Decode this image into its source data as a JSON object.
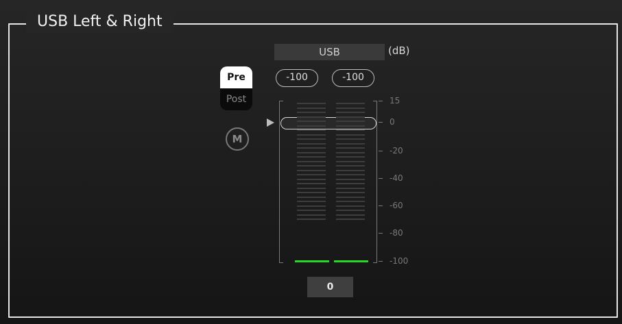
{
  "panel": {
    "title": "USB Left & Right"
  },
  "channel": {
    "name": "USB",
    "unit": "(dB)",
    "left_level": "-100",
    "right_level": "-100",
    "fader_value": "0"
  },
  "buttons": {
    "pre": "Pre",
    "post": "Post",
    "mute": "M",
    "selected": "Pre"
  },
  "scale": {
    "ticks": [
      "15",
      "0",
      "-20",
      "-40",
      "-60",
      "-80",
      "-100"
    ]
  },
  "colors": {
    "background": "#1d1d1d",
    "frame": "#e6e6e6",
    "meter_signal": "#27d827",
    "selected_button": "#ffffff"
  },
  "icons": {
    "fader_pointer": "triangle-right",
    "mute": "circle-M"
  }
}
